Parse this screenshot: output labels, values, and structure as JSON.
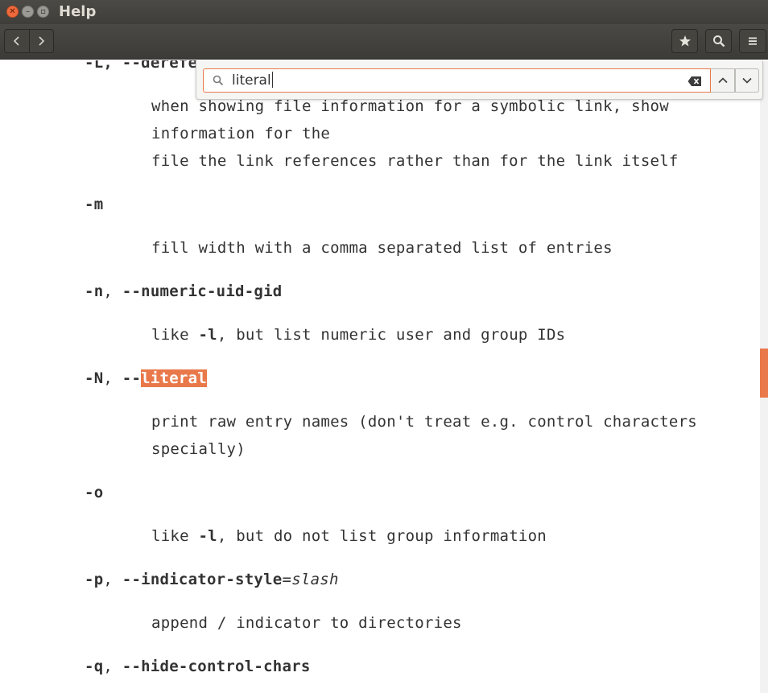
{
  "window": {
    "title": "Help"
  },
  "toolbar": {
    "back_icon": "chevron-left-icon",
    "forward_icon": "chevron-right-icon",
    "bookmark_icon": "star-icon",
    "search_icon": "search-icon",
    "menu_icon": "hamburger-menu-icon"
  },
  "find": {
    "value": "literal",
    "clear_icon": "backspace-clear-icon",
    "prev_icon": "chevron-up-icon",
    "next_icon": "chevron-down-icon"
  },
  "doc": {
    "partial_term": "-L, --derefe",
    "L_desc_1": "when showing file information for a symbolic link, show",
    "L_desc_2": "information for the",
    "L_desc_3": "file the link references rather than for the link itself",
    "m_term": "-m",
    "m_desc": "fill width with a comma separated list of entries",
    "n_term_a": "-n",
    "n_term_sep": ", ",
    "n_term_b": "--numeric-uid-gid",
    "n_desc_a": "like ",
    "n_desc_flag": "-l",
    "n_desc_b": ", but list numeric user and group IDs",
    "N_term_a": "-N",
    "N_term_sep": ", ",
    "N_term_dash": "--",
    "N_term_match": "literal",
    "N_desc_1": "print raw entry names (don't treat e.g. control characters",
    "N_desc_2": "specially)",
    "o_term": "-o",
    "o_desc_a": "like ",
    "o_desc_flag": "-l",
    "o_desc_b": ", but do not list group information",
    "p_term_a": "-p",
    "p_term_sep": ", ",
    "p_term_b": "--indicator-style",
    "p_term_eq": "=",
    "p_term_arg": "slash",
    "p_desc": "append / indicator to directories",
    "q_term_a": "-q",
    "q_term_sep": ", ",
    "q_term_b": "--hide-control-chars"
  },
  "colors": {
    "accent": "#e9794b",
    "text": "#333333",
    "toolbar": "#3f3e3a"
  }
}
